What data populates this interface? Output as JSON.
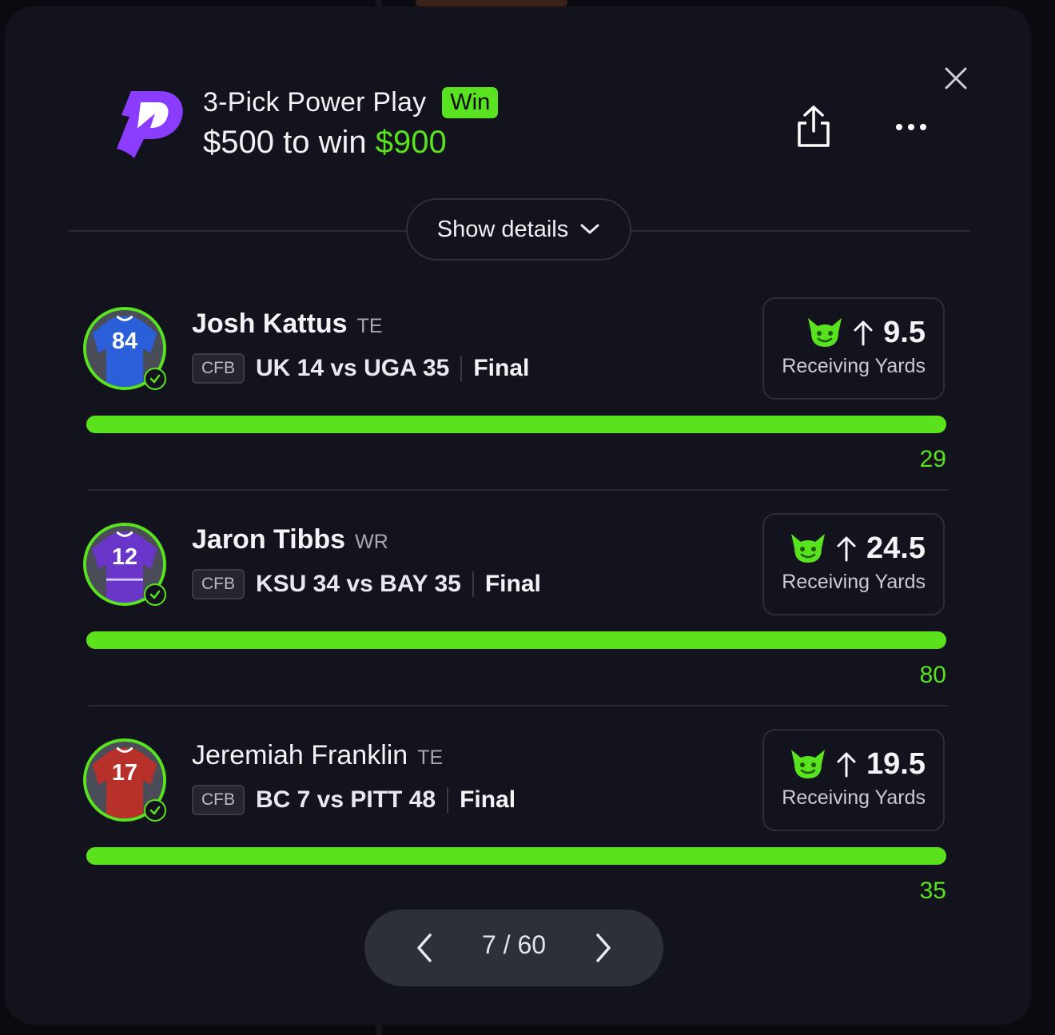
{
  "header": {
    "title": "3-Pick Power Play",
    "result_badge": "Win",
    "stake_prefix": "$500 to win ",
    "payout": "$900"
  },
  "details_toggle": {
    "label": "Show details"
  },
  "picks": [
    {
      "name": "Josh Kattus",
      "position": "TE",
      "league": "CFB",
      "matchup": "UK 14 vs UGA 35",
      "status": "Final",
      "jersey_number": "84",
      "jersey_color": "#2b5fd9",
      "direction": "↑",
      "line": "9.5",
      "stat": "Receiving Yards",
      "actual": "29",
      "progress": 1.0
    },
    {
      "name": "Jaron Tibbs",
      "position": "WR",
      "league": "CFB",
      "matchup": "KSU 34 vs BAY 35",
      "status": "Final",
      "jersey_number": "12",
      "jersey_color": "#6a35c9",
      "direction": "↑",
      "line": "24.5",
      "stat": "Receiving Yards",
      "actual": "80",
      "progress": 1.0
    },
    {
      "name": "Jeremiah Franklin",
      "position": "TE",
      "league": "CFB",
      "matchup": "BC 7 vs PITT 48",
      "status": "Final",
      "jersey_number": "17",
      "jersey_color": "#b8302a",
      "direction": "↑",
      "line": "19.5",
      "stat": "Receiving Yards",
      "actual": "35",
      "progress": 1.0
    }
  ],
  "pager": {
    "current": "7 / 60"
  },
  "colors": {
    "accent_green": "#58e21f",
    "brand_purple": "#8a3cff",
    "modal_bg": "#12131c"
  },
  "icons": {
    "close": "close-icon",
    "share": "share-icon",
    "more": "more-icon",
    "chevron": "chevron-down-icon",
    "goblin": "goblin-icon",
    "check": "check-icon"
  }
}
